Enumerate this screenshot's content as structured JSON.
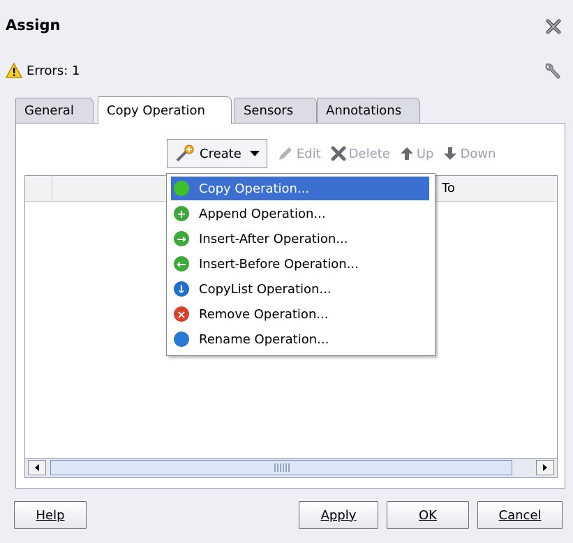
{
  "dialog": {
    "title": "Assign",
    "errors_text": "Errors: 1"
  },
  "tabs": [
    {
      "label": "General",
      "active": false
    },
    {
      "label": "Copy Operation",
      "active": true
    },
    {
      "label": "Sensors",
      "active": false
    },
    {
      "label": "Annotations",
      "active": false
    }
  ],
  "toolbar": {
    "create_label": "Create",
    "edit_label": "Edit",
    "delete_label": "Delete",
    "up_label": "Up",
    "down_label": "Down"
  },
  "table": {
    "columns": [
      "",
      "To"
    ]
  },
  "menu": {
    "items": [
      {
        "label": "Copy Operation...",
        "icon": "green-circle-icon",
        "color": "#3fbf2b"
      },
      {
        "label": "Append Operation...",
        "icon": "plus-circle-icon",
        "color": "#3fa83a"
      },
      {
        "label": "Insert-After Operation...",
        "icon": "arrow-right-circle-icon",
        "color": "#3fa83a"
      },
      {
        "label": "Insert-Before Operation...",
        "icon": "arrow-left-circle-icon",
        "color": "#3fa83a"
      },
      {
        "label": "CopyList Operation...",
        "icon": "arrow-down-circle-icon",
        "color": "#1f6fd0"
      },
      {
        "label": "Remove Operation...",
        "icon": "x-circle-icon",
        "color": "#d8402c"
      },
      {
        "label": "Rename Operation...",
        "icon": "blue-circle-icon",
        "color": "#2a78d8"
      }
    ]
  },
  "buttons": {
    "help": "Help",
    "apply": "Apply",
    "ok": "OK",
    "cancel": "Cancel"
  }
}
